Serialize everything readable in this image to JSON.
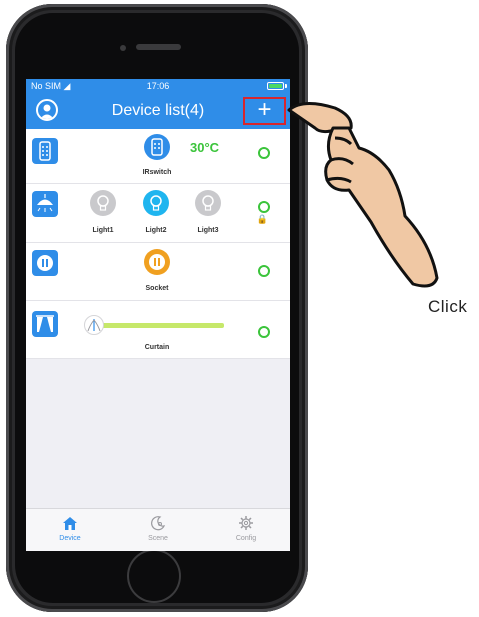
{
  "statusbar": {
    "carrier": "No SIM",
    "time": "17:06"
  },
  "navbar": {
    "title": "Device list(4)",
    "add_label": "+"
  },
  "devices": [
    {
      "category_icon": "remote-icon",
      "items": [
        {
          "label": "IRswitch",
          "icon": "remote-icon"
        }
      ],
      "temperature": "30°C",
      "status": "online"
    },
    {
      "category_icon": "ceiling-lamp-icon",
      "items": [
        {
          "label": "Light1",
          "icon": "bulb-off-icon"
        },
        {
          "label": "Light2",
          "icon": "bulb-on-icon"
        },
        {
          "label": "Light3",
          "icon": "bulb-off-icon"
        }
      ],
      "status": "online",
      "locked": true
    },
    {
      "category_icon": "socket-icon",
      "items": [
        {
          "label": "Socket",
          "icon": "socket-icon"
        }
      ],
      "status": "online"
    },
    {
      "category_icon": "curtain-icon",
      "items": [
        {
          "label": "Curtain",
          "icon": "curtain-slider"
        }
      ],
      "curtain_position": 0,
      "status": "online"
    }
  ],
  "tabbar": {
    "tabs": [
      {
        "label": "Device",
        "active": true
      },
      {
        "label": "Scene"
      },
      {
        "label": "Config"
      }
    ]
  },
  "annotation": {
    "text": "Click"
  },
  "colors": {
    "accent": "#2f8de8",
    "online": "#3bc43b",
    "highlight": "#d8262d",
    "bulb_on": "#1fb5ef",
    "socket": "#f0a020",
    "slider": "#c6e86a"
  }
}
